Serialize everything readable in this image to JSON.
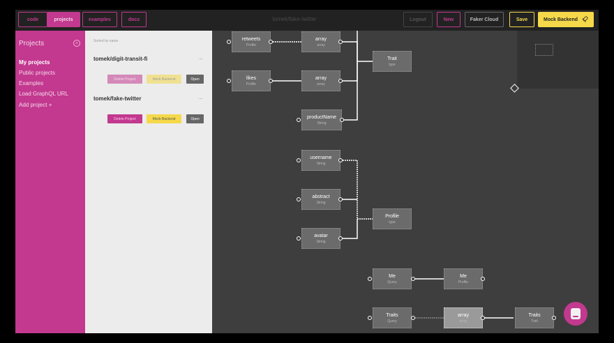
{
  "topbar": {
    "tabs": [
      {
        "label": "code",
        "active": false
      },
      {
        "label": "projects",
        "active": true
      },
      {
        "label": "examples",
        "active": false
      },
      {
        "label": "docs",
        "active": false
      }
    ],
    "title": "tomek/fake-twitter",
    "logout_label": "Logout",
    "new_label": "New",
    "faker_cloud_label": "Faker Cloud",
    "save_label": "Save",
    "mock_backend_label": "Mock Backend",
    "rocket_icon": "rocket-icon"
  },
  "sidebar": {
    "title": "Projects",
    "close_icon": "close-icon",
    "items": [
      {
        "label": "My projects",
        "active": true
      },
      {
        "label": "Public projects",
        "active": false
      },
      {
        "label": "Examples",
        "active": false
      },
      {
        "label": "Load GraphQL URL",
        "active": false
      },
      {
        "label": "Add project +",
        "active": false
      }
    ]
  },
  "projects_panel": {
    "heading": "Sorted by name",
    "projects": [
      {
        "name": "tomek/digit-transit-fi",
        "menu": "...",
        "delete_label": "Delete Project",
        "mock_label": "Mock Backend",
        "open_label": "Open"
      },
      {
        "name": "tomek/fake-twitter",
        "menu": "...",
        "delete_label": "Delete Project",
        "mock_label": "Mock Backend",
        "open_label": "Open"
      }
    ]
  },
  "graph": {
    "nodes": {
      "retweets": {
        "title": "retweets",
        "type": "Profile"
      },
      "array1": {
        "title": "array",
        "type": "array"
      },
      "likes": {
        "title": "likes",
        "type": "Profile"
      },
      "array2": {
        "title": "array",
        "type": "array"
      },
      "trait": {
        "title": "Trait",
        "type": "type"
      },
      "productName": {
        "title": "productName",
        "type": "String"
      },
      "username": {
        "title": "username",
        "type": "String"
      },
      "abstract": {
        "title": "abstract",
        "type": "String"
      },
      "avatar": {
        "title": "avatar",
        "type": "String"
      },
      "profile": {
        "title": "Profile",
        "type": "type"
      },
      "me": {
        "title": "Me",
        "type": "Query"
      },
      "meProfile": {
        "title": "Me",
        "type": "Profile"
      },
      "traits": {
        "title": "Traits",
        "type": "Query"
      },
      "array3": {
        "title": "array",
        "type": "array"
      },
      "traitsType": {
        "title": "Traits",
        "type": "Trait"
      }
    }
  },
  "colors": {
    "accent_pink": "#c2398f",
    "accent_yellow": "#f5d94a",
    "canvas": "#3e3e3e",
    "node": "#6b6b6b"
  }
}
